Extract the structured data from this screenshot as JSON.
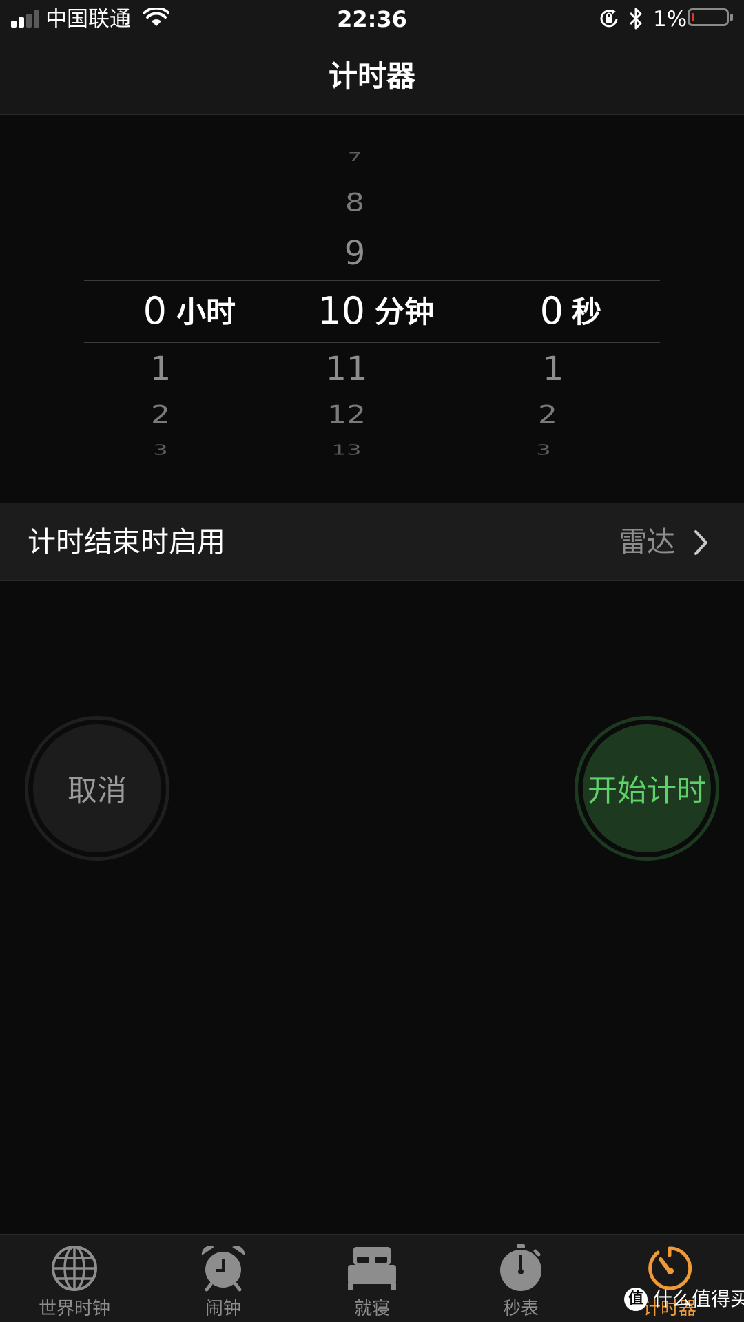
{
  "status_bar": {
    "carrier": "中国联通",
    "time": "22:36",
    "battery_percent": "1%",
    "battery_level": 0.01,
    "colors": {
      "battery_low": "#e0362c"
    },
    "icons": [
      "signal-icon",
      "wifi-icon",
      "rotation-lock-icon",
      "bluetooth-icon",
      "battery-icon"
    ]
  },
  "nav": {
    "title": "计时器"
  },
  "picker": {
    "hours": {
      "above": [
        "",
        "",
        ""
      ],
      "selected": "0",
      "unit": "小时",
      "below": [
        "1",
        "2",
        "3"
      ]
    },
    "minutes": {
      "above": [
        "7",
        "8",
        "9"
      ],
      "selected": "10",
      "unit": "分钟",
      "below": [
        "11",
        "12",
        "13"
      ]
    },
    "seconds": {
      "above": [
        "",
        "",
        ""
      ],
      "selected": "0",
      "unit": "秒",
      "below": [
        "1",
        "2",
        "3"
      ]
    }
  },
  "settings": {
    "label": "计时结束时启用",
    "value": "雷达"
  },
  "buttons": {
    "cancel": "取消",
    "start": "开始计时"
  },
  "tabs": [
    {
      "label": "世界时钟",
      "icon": "globe-icon"
    },
    {
      "label": "闹钟",
      "icon": "alarm-clock-icon"
    },
    {
      "label": "就寝",
      "icon": "bed-icon"
    },
    {
      "label": "秒表",
      "icon": "stopwatch-icon"
    },
    {
      "label": "计时器",
      "icon": "timer-icon",
      "active": true
    }
  ],
  "colors": {
    "accent": "#f09a37",
    "start_green": "#5fd169"
  },
  "watermark": {
    "badge": "值",
    "text": "什么值得买"
  }
}
